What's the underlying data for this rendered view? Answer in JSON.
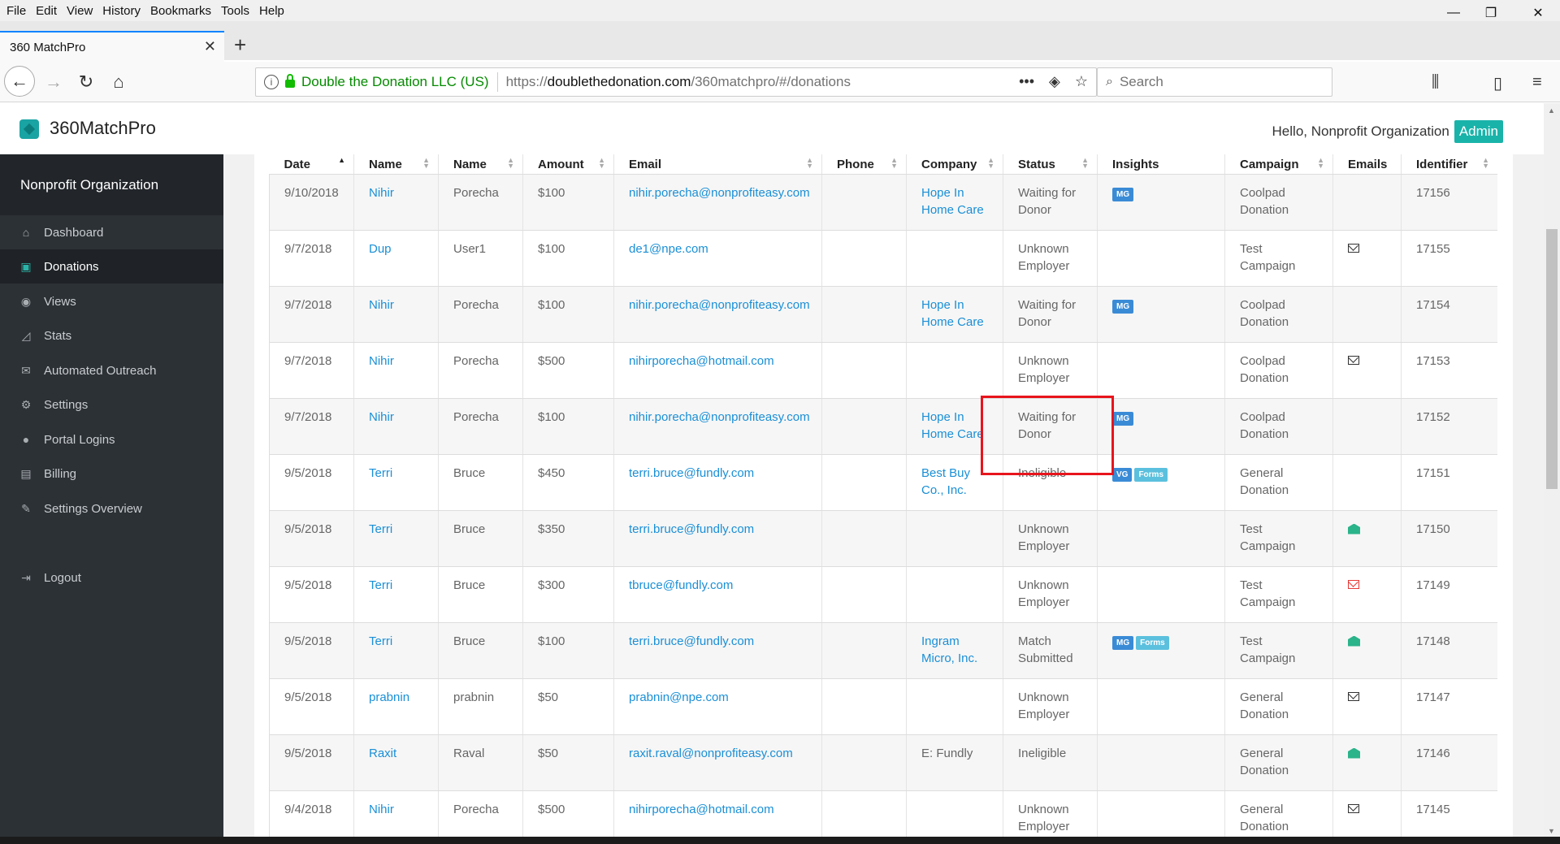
{
  "menubar": [
    "File",
    "Edit",
    "View",
    "History",
    "Bookmarks",
    "Tools",
    "Help"
  ],
  "window": {
    "minimize": "—",
    "restore": "❐",
    "close": "✕"
  },
  "tab": {
    "title": "360 MatchPro",
    "close": "✕",
    "new": "+"
  },
  "nav": {
    "back": "←",
    "forward": "→",
    "reload": "↻",
    "home": "⌂"
  },
  "urlbar": {
    "info": "i",
    "org": "Double the Donation LLC (US)",
    "url_prefix": "https://",
    "url_host": "doublethedonation.com",
    "url_path": "/360matchpro/#/donations",
    "more": "•••",
    "pocket": "◈",
    "bookmark": "☆"
  },
  "search": {
    "placeholder": "Search",
    "icon": "search-icon"
  },
  "toolbar": {
    "library": "⫼",
    "sidebar": "▯",
    "menu": "≡"
  },
  "app": {
    "title": "360MatchPro",
    "greeting": "Hello, Nonprofit Organization",
    "admin": "Admin",
    "brand_color": "#19b3a9"
  },
  "sidebar": {
    "org": "Nonprofit Organization",
    "items": [
      {
        "label": "Dashboard",
        "icon": "⌂",
        "name": "home-icon"
      },
      {
        "label": "Donations",
        "icon": "▣",
        "name": "money-icon"
      },
      {
        "label": "Views",
        "icon": "◉",
        "name": "eye-icon"
      },
      {
        "label": "Stats",
        "icon": "◿",
        "name": "chart-icon"
      },
      {
        "label": "Automated Outreach",
        "icon": "✉",
        "name": "envelope-icon"
      },
      {
        "label": "Settings",
        "icon": "⚙",
        "name": "gears-icon"
      },
      {
        "label": "Portal Logins",
        "icon": "●",
        "name": "user-icon"
      },
      {
        "label": "Billing",
        "icon": "▤",
        "name": "billing-icon"
      },
      {
        "label": "Settings Overview",
        "icon": "✎",
        "name": "wrench-icon"
      },
      {
        "label": "Logout",
        "icon": "⇥",
        "name": "logout-icon"
      }
    ]
  },
  "table": {
    "columns": [
      "Date",
      "Name",
      "Name",
      "Amount",
      "Email",
      "Phone",
      "Company",
      "Status",
      "Insights",
      "Campaign",
      "Emails",
      "Identifier"
    ],
    "rows": [
      {
        "date": "9/10/2018",
        "first": "Nihir",
        "last": "Porecha",
        "amount": "$100",
        "email": "nihir.porecha@nonprofiteasy.com",
        "phone": "",
        "company": "Hope In Home Care",
        "company_link": true,
        "status": "Waiting for Donor",
        "insights": [
          "MG"
        ],
        "campaign": "Coolpad Donation",
        "emails": "",
        "id": "17156"
      },
      {
        "date": "9/7/2018",
        "first": "Dup",
        "last": "User1",
        "amount": "$100",
        "email": "de1@npe.com",
        "phone": "",
        "company": "",
        "company_link": false,
        "status": "Unknown Employer",
        "insights": [],
        "campaign": "Test Campaign",
        "emails": "mail",
        "id": "17155"
      },
      {
        "date": "9/7/2018",
        "first": "Nihir",
        "last": "Porecha",
        "amount": "$100",
        "email": "nihir.porecha@nonprofiteasy.com",
        "phone": "",
        "company": "Hope In Home Care",
        "company_link": true,
        "status": "Waiting for Donor",
        "insights": [
          "MG"
        ],
        "campaign": "Coolpad Donation",
        "emails": "",
        "id": "17154"
      },
      {
        "date": "9/7/2018",
        "first": "Nihir",
        "last": "Porecha",
        "amount": "$500",
        "email": "nihirporecha@hotmail.com",
        "phone": "",
        "company": "",
        "company_link": false,
        "status": "Unknown Employer",
        "insights": [],
        "campaign": "Coolpad Donation",
        "emails": "mail",
        "id": "17153"
      },
      {
        "date": "9/7/2018",
        "first": "Nihir",
        "last": "Porecha",
        "amount": "$100",
        "email": "nihir.porecha@nonprofiteasy.com",
        "phone": "",
        "company": "Hope In Home Care",
        "company_link": true,
        "status": "Waiting for Donor",
        "insights": [
          "MG"
        ],
        "campaign": "Coolpad Donation",
        "emails": "",
        "id": "17152"
      },
      {
        "date": "9/5/2018",
        "first": "Terri",
        "last": "Bruce",
        "amount": "$450",
        "email": "terri.bruce@fundly.com",
        "phone": "",
        "company": "Best Buy Co., Inc.",
        "company_link": true,
        "status": "Ineligible",
        "insights": [
          "VG",
          "Forms"
        ],
        "campaign": "General Donation",
        "emails": "",
        "id": "17151"
      },
      {
        "date": "9/5/2018",
        "first": "Terri",
        "last": "Bruce",
        "amount": "$350",
        "email": "terri.bruce@fundly.com",
        "phone": "",
        "company": "",
        "company_link": false,
        "status": "Unknown Employer",
        "insights": [],
        "campaign": "Test Campaign",
        "emails": "open",
        "id": "17150"
      },
      {
        "date": "9/5/2018",
        "first": "Terri",
        "last": "Bruce",
        "amount": "$300",
        "email": "tbruce@fundly.com",
        "phone": "",
        "company": "",
        "company_link": false,
        "status": "Unknown Employer",
        "insights": [],
        "campaign": "Test Campaign",
        "emails": "red",
        "id": "17149"
      },
      {
        "date": "9/5/2018",
        "first": "Terri",
        "last": "Bruce",
        "amount": "$100",
        "email": "terri.bruce@fundly.com",
        "phone": "",
        "company": "Ingram Micro, Inc.",
        "company_link": true,
        "status": "Match Submitted",
        "insights": [
          "MG",
          "Forms"
        ],
        "campaign": "Test Campaign",
        "emails": "open",
        "id": "17148"
      },
      {
        "date": "9/5/2018",
        "first": "prabnin",
        "last": "prabnin",
        "amount": "$50",
        "email": "prabnin@npe.com",
        "phone": "",
        "company": "",
        "company_link": false,
        "status": "Unknown Employer",
        "insights": [],
        "campaign": "General Donation",
        "emails": "mail",
        "id": "17147"
      },
      {
        "date": "9/5/2018",
        "first": "Raxit",
        "last": "Raval",
        "amount": "$50",
        "email": "raxit.raval@nonprofiteasy.com",
        "phone": "",
        "company": "E: Fundly",
        "company_link": false,
        "status": "Ineligible",
        "insights": [],
        "campaign": "General Donation",
        "emails": "open",
        "id": "17146"
      },
      {
        "date": "9/4/2018",
        "first": "Nihir",
        "last": "Porecha",
        "amount": "$500",
        "email": "nihirporecha@hotmail.com",
        "phone": "",
        "company": "",
        "company_link": false,
        "status": "Unknown Employer",
        "insights": [],
        "campaign": "General Donation",
        "emails": "mail",
        "id": "17145"
      }
    ]
  }
}
